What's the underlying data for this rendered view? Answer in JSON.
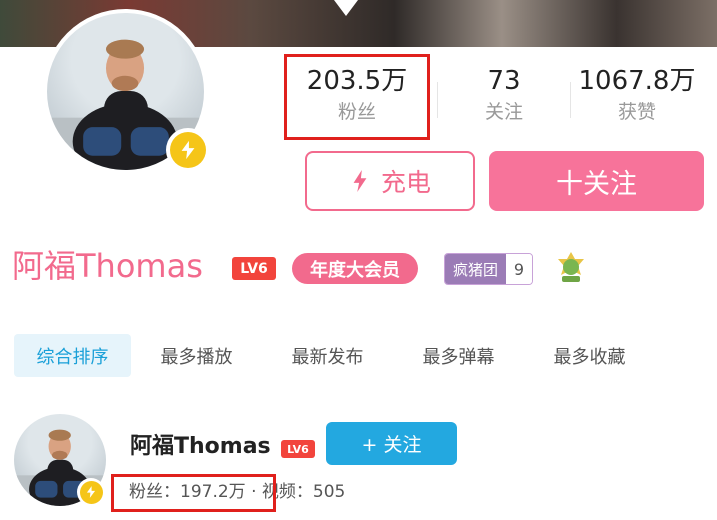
{
  "profile": {
    "name": "阿福Thomas",
    "level": "LV6",
    "vip_badge": "年度大会员",
    "fan_group": {
      "name": "疯猪团",
      "level": "9"
    }
  },
  "stats": [
    {
      "value": "203.5万",
      "label": "粉丝"
    },
    {
      "value": "73",
      "label": "关注"
    },
    {
      "value": "1067.8万",
      "label": "获赞"
    }
  ],
  "actions": {
    "charge_label": "充电",
    "follow_label": "十关注"
  },
  "tabs": [
    "综合排序",
    "最多播放",
    "最新发布",
    "最多弹幕",
    "最多收藏"
  ],
  "search_result": {
    "name": "阿福Thomas",
    "level": "LV6",
    "follow_label": "+ 关注",
    "meta": "粉丝：197.2万 · 视频：505"
  },
  "colors": {
    "pink": "#f26a8d",
    "pink_button": "#f7739a",
    "blue": "#23a8e0",
    "highlight_box": "#e0201c",
    "badge_yellow": "#f5c518"
  },
  "icons": [
    "lightning-icon",
    "fan-medal-icon"
  ]
}
